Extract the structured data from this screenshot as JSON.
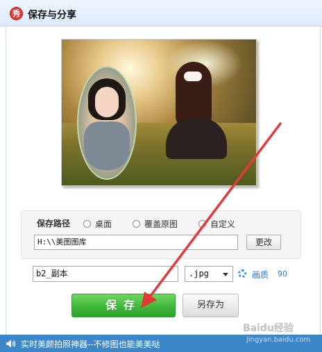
{
  "window": {
    "title": "保存与分享",
    "app_icon_glyph": "秀"
  },
  "save_path": {
    "label": "保存路径",
    "options": [
      "桌面",
      "覆盖原图",
      "自定义"
    ],
    "selected_option": null,
    "path_value": "H:\\\\美图图库",
    "change_label": "更改"
  },
  "file": {
    "name_value": "b2_副本",
    "format_value": ".jpg",
    "quality_label": "画质",
    "quality_value": "90"
  },
  "actions": {
    "save_label": "保存",
    "save_as_label": "另存为"
  },
  "status": {
    "tip": "实时美颜拍照神器--不修图也能美美哒"
  },
  "watermark": {
    "brand": "Baidu经验",
    "site": "jingyan.baidu.com"
  },
  "colors": {
    "save_button": "#3fb83b",
    "status_bar": "#3b87c9",
    "annotation_arrow": "#e03a3a",
    "link_blue": "#2a7acb"
  },
  "icons": {
    "app": "meitu-logo-icon",
    "speaker": "speaker-icon",
    "quality": "gear-icon",
    "dropdown": "chevron-down-icon"
  }
}
